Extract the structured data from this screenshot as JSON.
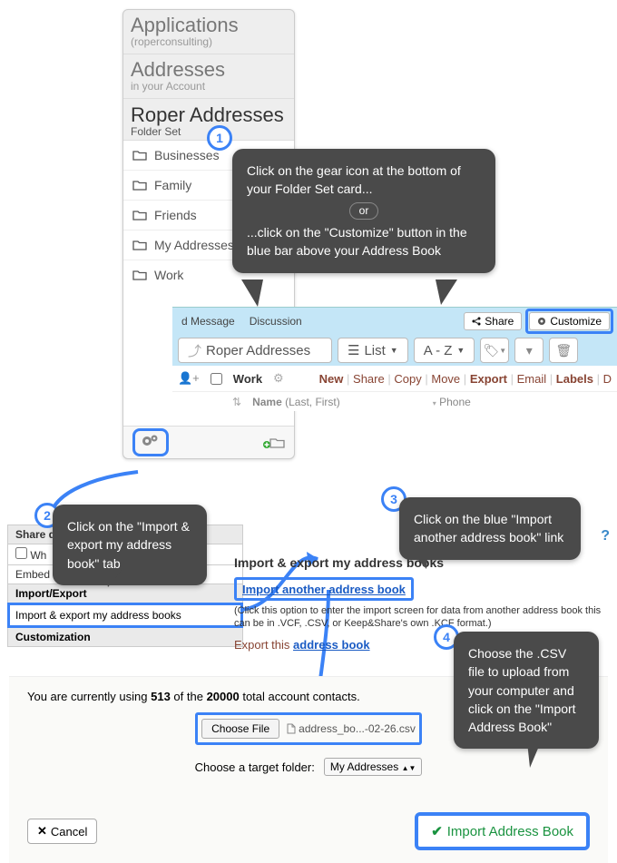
{
  "card": {
    "apps_title": "Applications",
    "org": "(roperconsulting)",
    "addresses_title": "Addresses",
    "addresses_sub": "in your Account",
    "set_title": "Roper Addresses",
    "set_sub": "Folder Set",
    "folders": [
      "Businesses",
      "Family",
      "Friends",
      "My Addresses",
      "Work"
    ]
  },
  "toolbar": {
    "message_label": "d Message",
    "discussion_label": "Discussion",
    "share_label": "Share",
    "customize_label": "Customize",
    "breadcrumb": "Roper Addresses",
    "list_label": "List",
    "sort_label": "A - Z",
    "work_label": "Work",
    "actions": {
      "new": "New",
      "share": "Share",
      "copy": "Copy",
      "move": "Move",
      "export": "Export",
      "email": "Email",
      "labels": "Labels",
      "d": "D"
    },
    "col_name": "Name",
    "col_name_hint": "(Last, First)",
    "col_phone": "Phone"
  },
  "panel": {
    "share_header": "Share d",
    "row_wh": "Wh",
    "row_embed": "Embed",
    "import_header": "Import/Export",
    "import_row": "Import & export my address books",
    "cust_header": "Customization",
    "tab_title": "Import & export my address books",
    "link_import_another": "Import another address book",
    "hint": "(Click this option to enter the import screen for data from another address book this can be in .VCF, .CSV, or Keep&Share's own .KCF format.)",
    "export_this_prefix": "Export this ",
    "export_this_link": "address book"
  },
  "upload": {
    "status_prefix": "You are currently using ",
    "used": "513",
    "status_mid": " of the ",
    "total": "20000",
    "status_suffix": " total account contacts.",
    "choose_file": "Choose File",
    "filename": "address_bo...-02-26.csv",
    "target_label": "Choose a target folder:",
    "target_value": "My Addresses",
    "cancel": "Cancel",
    "import_btn": "Import Address Book"
  },
  "callouts": {
    "c1a": "Click on the gear icon at the bottom of your Folder Set card...",
    "c1_or": "or",
    "c1b": "...click on the \"Customize\" button in the blue bar above your Address Book",
    "c2": "Click on the \"Import & export my address book\" tab",
    "c3": "Click on the blue \"Import another address book\" link",
    "c4": "Choose the .CSV file to upload from your computer and click on the \"Import Address Book\""
  },
  "nums": {
    "n1": "1",
    "n2": "2",
    "n3": "3",
    "n4": "4"
  }
}
